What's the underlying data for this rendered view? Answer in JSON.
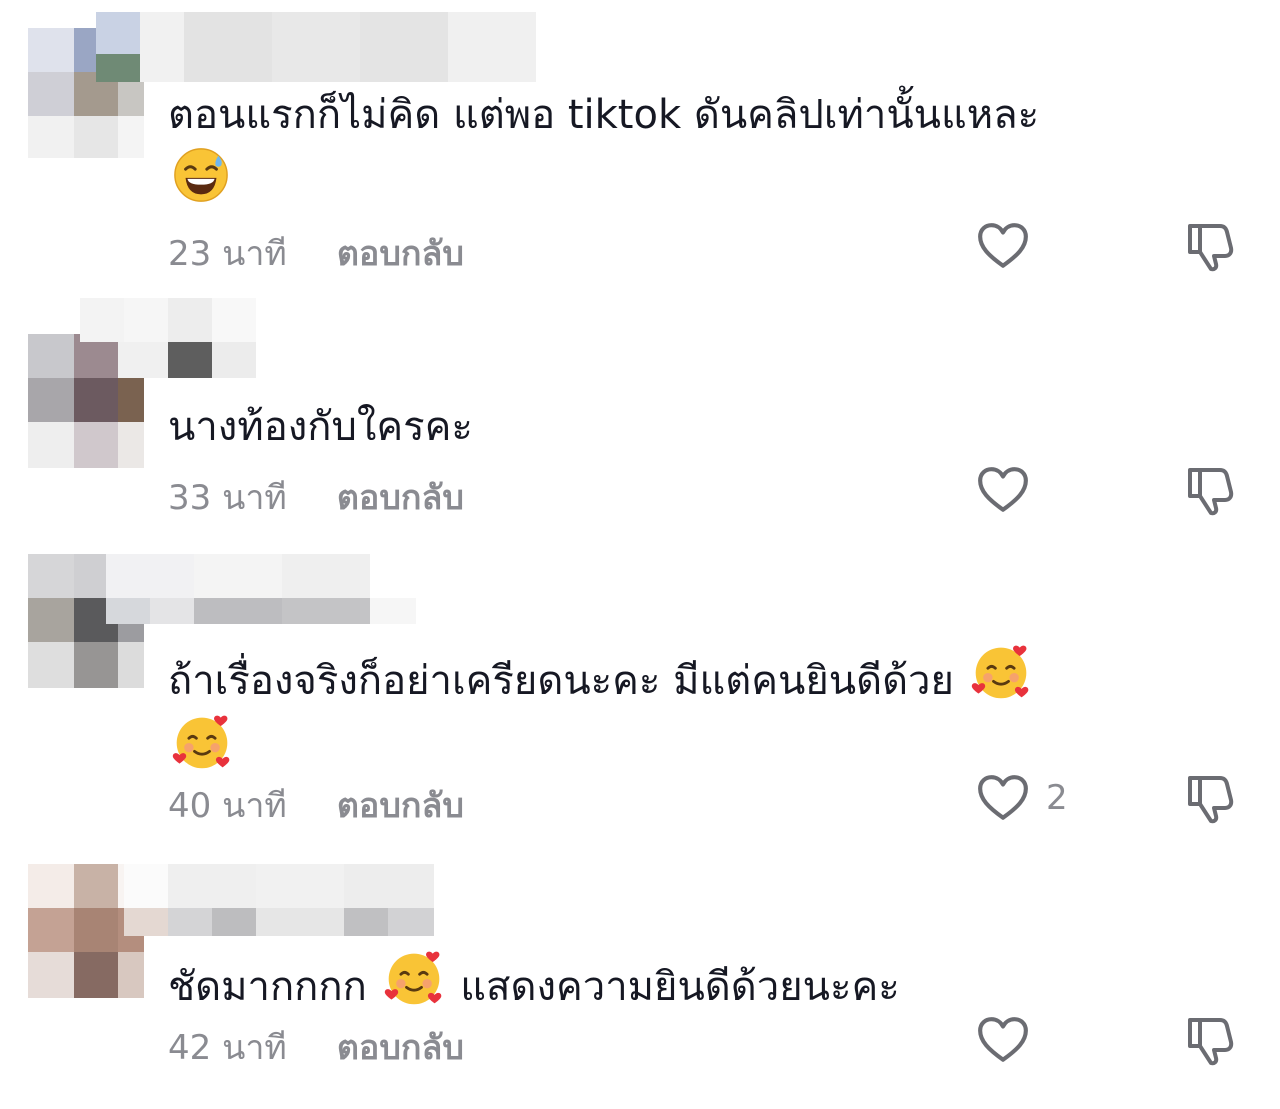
{
  "comments": [
    {
      "text": "ตอนแรกก็ไม่คิด แต่พอ tiktok ดันคลิปเท่านั้นแหละ",
      "emoji": "grinning-sweat",
      "time": "23 นาที",
      "reply": "ตอบกลับ",
      "likes": ""
    },
    {
      "text": "นางท้องกับใครคะ",
      "emoji": "",
      "time": "33 นาที",
      "reply": "ตอบกลับ",
      "likes": ""
    },
    {
      "text": "ถ้าเรื่องจริงก็อย่าเครียดนะคะ มีแต่คนยินดีด้วย",
      "emoji": "smiling-face-hearts",
      "time": "40 นาที",
      "reply": "ตอบกลับ",
      "likes": "2"
    },
    {
      "text_before": "ชัดมากกกก",
      "text_after": "แสดงความยินดีด้วยนะคะ",
      "emoji": "smiling-face-hearts",
      "time": "42 นาที",
      "reply": "ตอบกลับ",
      "likes": ""
    }
  ],
  "colors": {
    "text": "#161823",
    "meta": "#8a8b91",
    "icon": "#6b6c72"
  }
}
